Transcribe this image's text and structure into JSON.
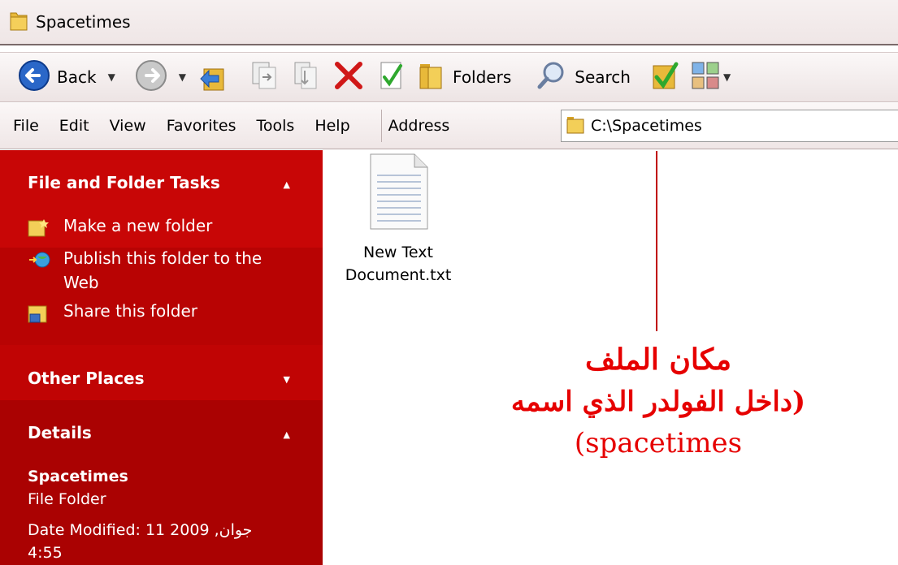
{
  "window": {
    "title": "Spacetimes"
  },
  "toolbar": {
    "back_label": "Back",
    "folders_label": "Folders",
    "search_label": "Search"
  },
  "menu": {
    "items": [
      "File",
      "Edit",
      "View",
      "Favorites",
      "Tools",
      "Help"
    ],
    "address_label": "Address",
    "address_value": "C:\\Spacetimes"
  },
  "taskpane": {
    "file_folder_tasks": {
      "title": "File and Folder Tasks",
      "items": [
        "Make a new folder",
        "Publish this folder to the Web",
        "Share this folder"
      ]
    },
    "other_places": {
      "title": "Other Places"
    },
    "details": {
      "title": "Details",
      "name": "Spacetimes",
      "type": "File Folder",
      "date_modified": "Date Modified: 11 2009 ,جوان",
      "time": "4:55"
    }
  },
  "files": [
    {
      "name_line1": "New Text",
      "name_line2": "Document.txt"
    }
  ],
  "annotation": {
    "line1": "مكان الملف",
    "line2": "(داخل الفولدر الذي اسمه",
    "line3": "(spacetimes",
    "color": "#e60000"
  },
  "colors": {
    "pane_bg": "#c40404"
  }
}
